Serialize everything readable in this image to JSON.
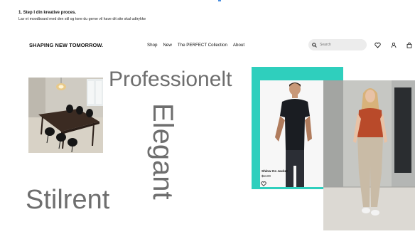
{
  "instruction": {
    "title": "1. Step I din kreative proces.",
    "description": "Lav et moodboard med den stil og tone du gerne vil have dit site skal udtrykke"
  },
  "nav": {
    "brand": "SHAPING NEW TOMORROW.",
    "links": [
      "Shop",
      "New",
      "The PERFECT Collection",
      "About"
    ],
    "search_placeholder": "Search",
    "icons": [
      "search-icon",
      "heart-icon",
      "user-icon",
      "bag-icon"
    ]
  },
  "moodboard": {
    "words": [
      "Professionelt",
      "Elegant",
      "Stilrent"
    ],
    "product": {
      "name": "Shlow Oo Jacket",
      "price": "$64.00"
    }
  },
  "colors": {
    "teal": "#2fcfbd",
    "word_gray": "#6e6e6e"
  }
}
